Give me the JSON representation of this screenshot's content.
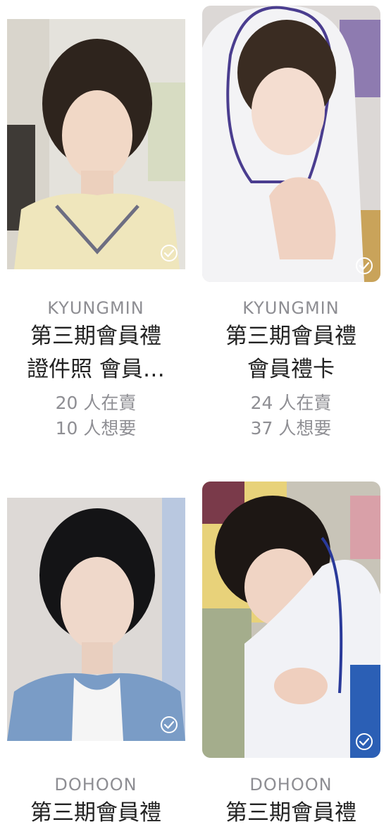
{
  "cards": [
    {
      "artist": "KYUNGMIN",
      "title_line1": "第三期會員禮",
      "title_line2": "證件照 會員…",
      "selling": "20 人在賣",
      "wanting": "10 人想要"
    },
    {
      "artist": "KYUNGMIN",
      "title_line1": "第三期會員禮",
      "title_line2": "會員禮卡",
      "selling": "24 人在賣",
      "wanting": "37 人想要"
    },
    {
      "artist": "DOHOON",
      "title_line1": "第三期會員禮",
      "title_line2": "",
      "selling": "",
      "wanting": ""
    },
    {
      "artist": "DOHOON",
      "title_line1": "第三期會員禮",
      "title_line2": "",
      "selling": "",
      "wanting": ""
    }
  ],
  "icons": {
    "selected": "check-circle-icon"
  },
  "colors": {
    "muted_text": "#8e8e93",
    "title_text": "#222222"
  }
}
